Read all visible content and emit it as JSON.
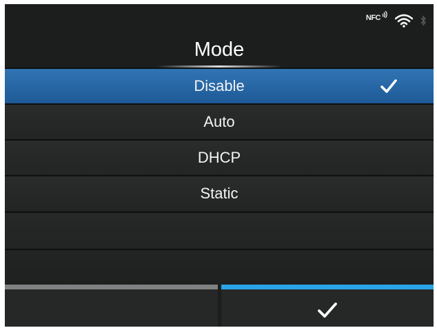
{
  "status_bar": {
    "icons": [
      "nfc-icon",
      "wifi-icon",
      "bluetooth-icon"
    ],
    "nfc_label": "NFC"
  },
  "title": "Mode",
  "options": [
    {
      "label": "Disable",
      "selected": true
    },
    {
      "label": "Auto",
      "selected": false
    },
    {
      "label": "DHCP",
      "selected": false
    },
    {
      "label": "Static",
      "selected": false
    }
  ],
  "softkeys": {
    "left": {
      "icon": "none",
      "indicator_color": "#7f8182"
    },
    "right": {
      "icon": "checkmark-icon",
      "indicator_color": "#2aa3e8"
    }
  },
  "colors": {
    "selected_row": "#2a6aa8",
    "background": "#1c1d1d",
    "accent": "#2aa3e8"
  }
}
